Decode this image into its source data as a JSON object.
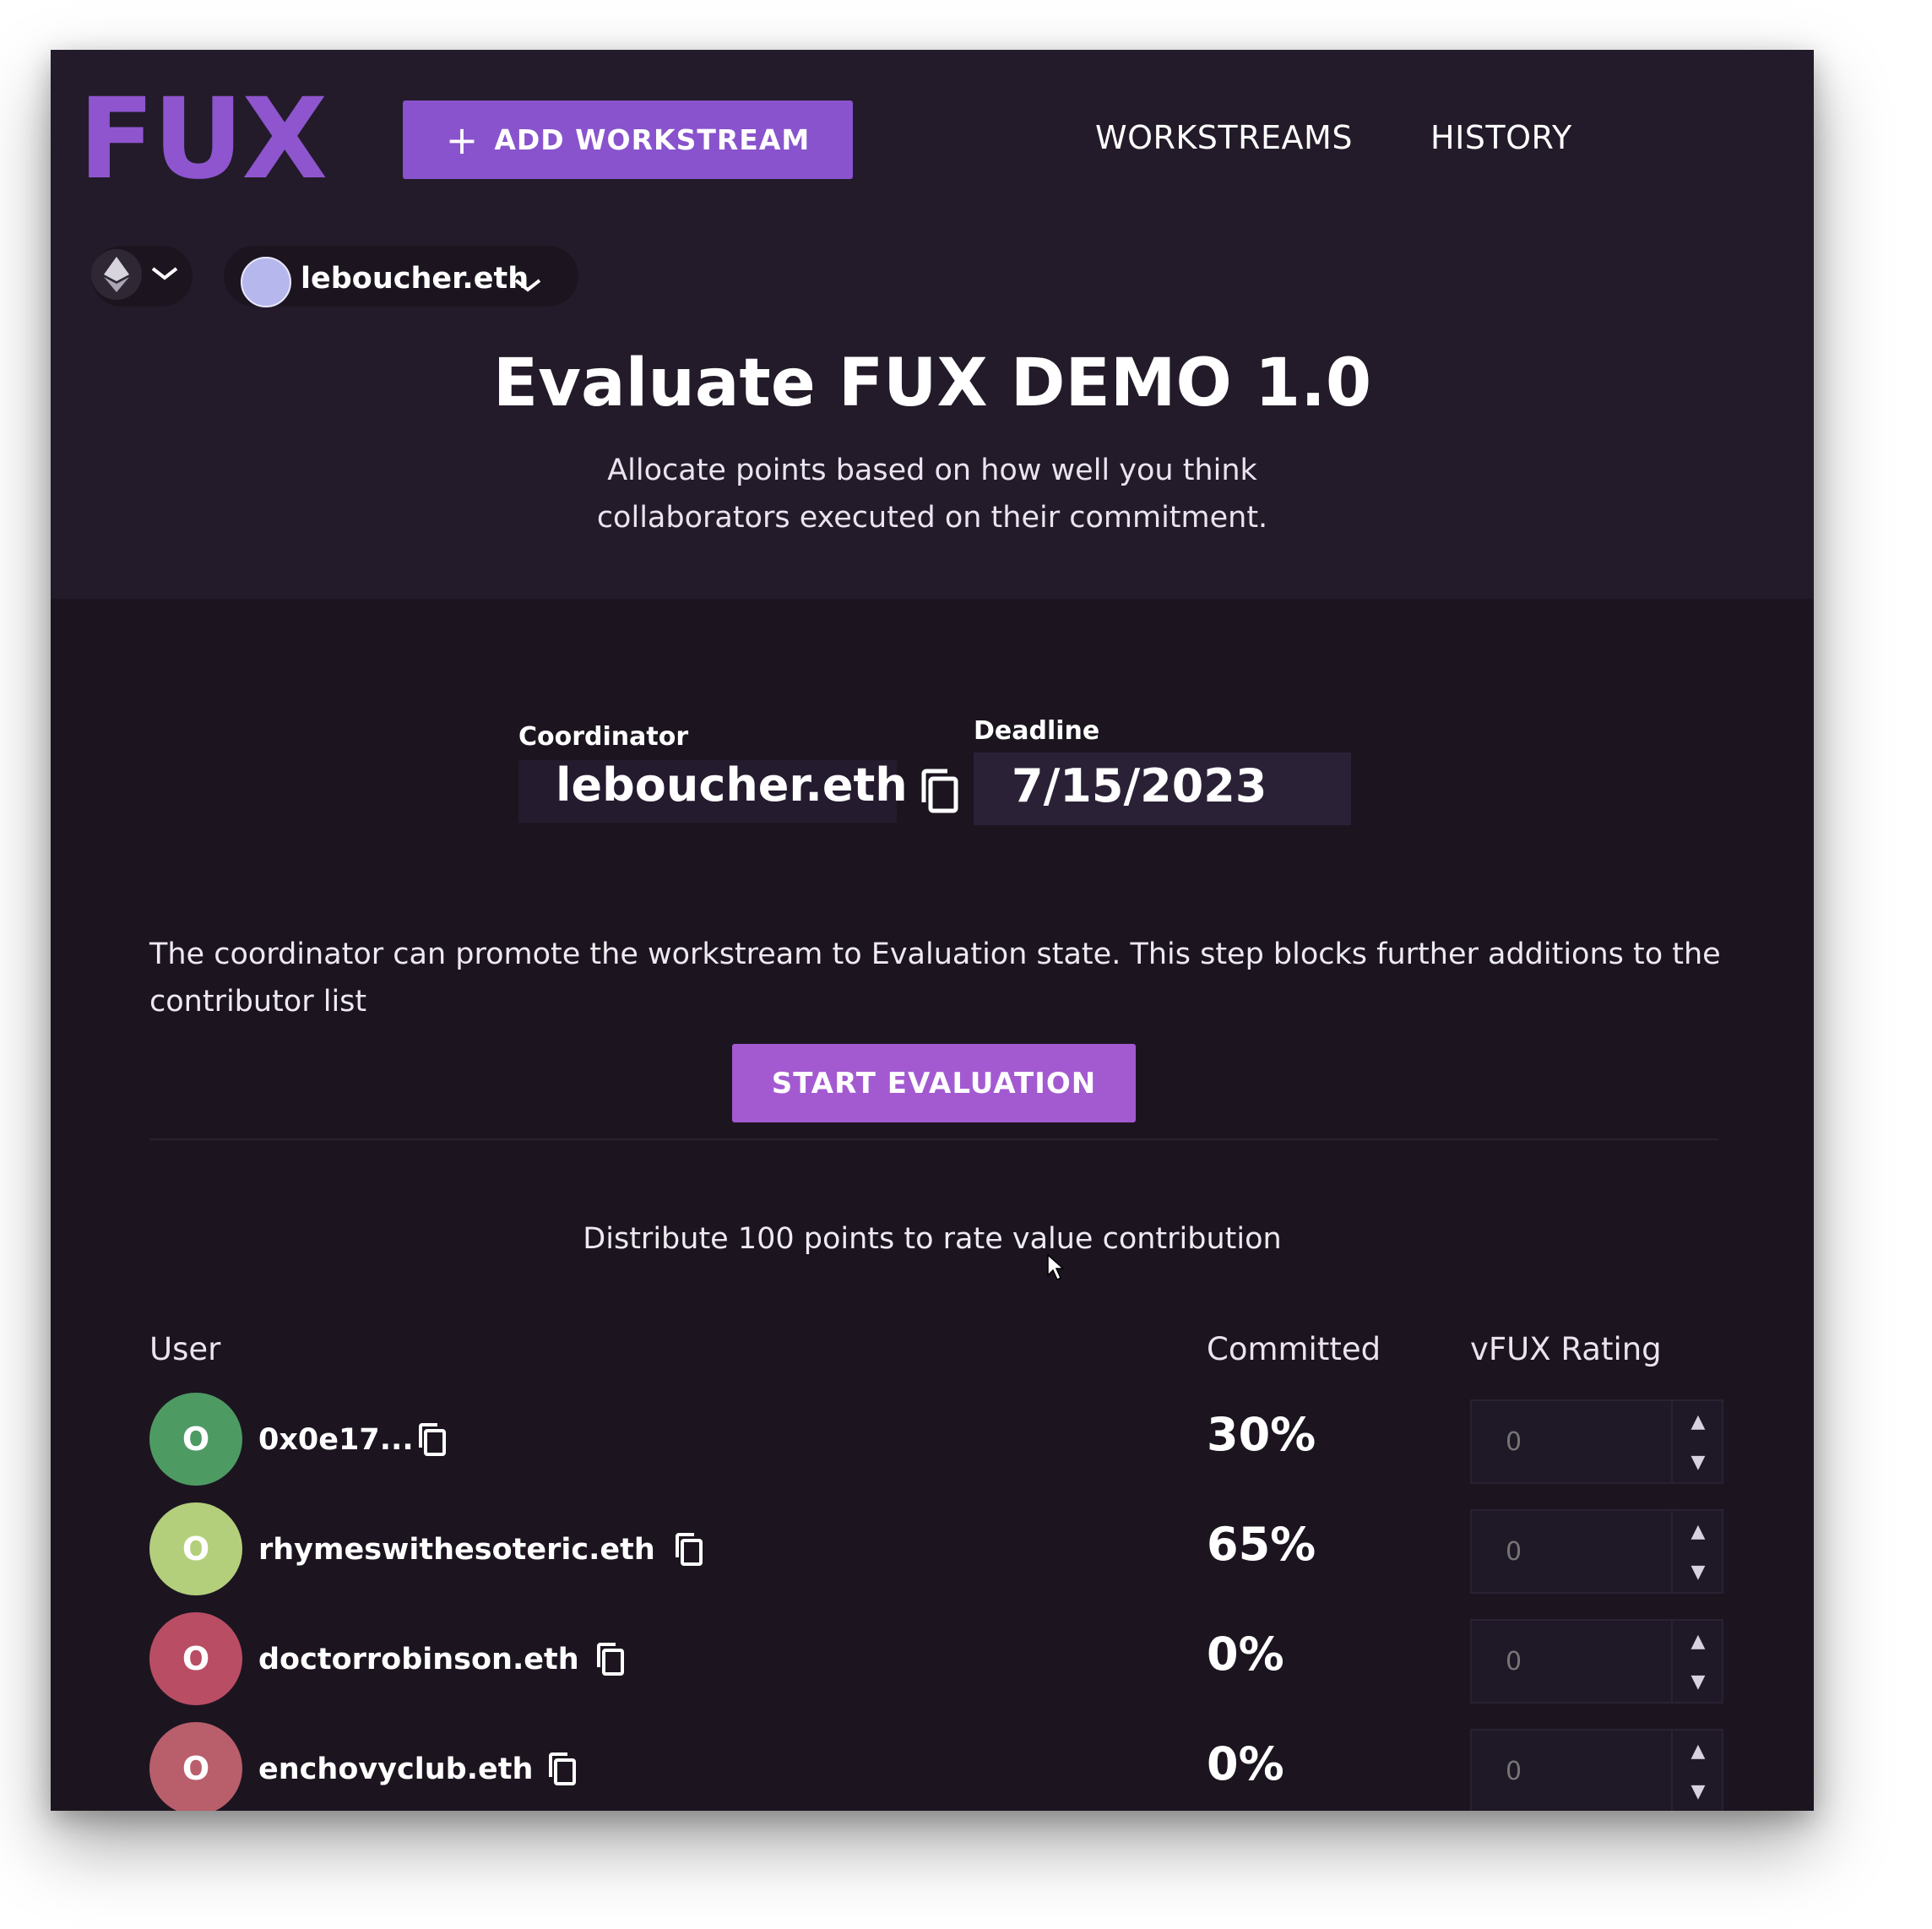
{
  "app": {
    "logo": "FUX"
  },
  "header": {
    "add_button_icon": "plus-icon",
    "add_button_label": "ADD WORKSTREAM",
    "nav": [
      "WORKSTREAMS",
      "HISTORY"
    ]
  },
  "account": {
    "chain_icon": "ethereum-icon",
    "name": "leboucher.eth"
  },
  "page": {
    "title": "Evaluate FUX DEMO 1.0",
    "subtitle_line1": "Allocate points based on how well you think",
    "subtitle_line2": "collaborators executed on their commitment."
  },
  "coordinator": {
    "label": "Coordinator",
    "value": "leboucher.eth"
  },
  "deadline": {
    "label": "Deadline",
    "value": "7/15/2023"
  },
  "evaluation": {
    "info": "The coordinator can promote the workstream to Evaluation state. This step blocks further additions to the contributor list",
    "start_button": "START EVALUATION"
  },
  "distribution": {
    "instruction": "Distribute 100 points to rate value contribution"
  },
  "table": {
    "columns": {
      "user": "User",
      "committed": "Committed",
      "rating": "vFUX Rating"
    },
    "rows": [
      {
        "initial": "O",
        "name": "0x0e17...",
        "committed": "30%",
        "rating_placeholder": "0",
        "avatar_color": "#4e9a63"
      },
      {
        "initial": "O",
        "name": "rhymeswithesoteric.eth",
        "committed": "65%",
        "rating_placeholder": "0",
        "avatar_color": "#b4cf7c"
      },
      {
        "initial": "O",
        "name": "doctorrobinson.eth",
        "committed": "0%",
        "rating_placeholder": "0",
        "avatar_color": "#b94d64"
      },
      {
        "initial": "O",
        "name": "enchovyclub.eth",
        "committed": "0%",
        "rating_placeholder": "0",
        "avatar_color": "#b95e6b"
      }
    ]
  },
  "colors": {
    "accent": "#8853cd",
    "start_button": "#a35ad0",
    "background": "#1c1520"
  }
}
